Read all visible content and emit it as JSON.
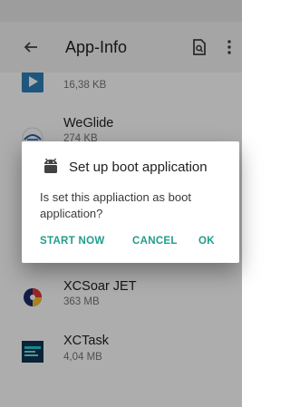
{
  "app_bar": {
    "title": "App-Info",
    "back_icon": "arrow-back-icon",
    "search_icon": "find-in-page-icon",
    "more_icon": "more-vert-icon"
  },
  "apps": [
    {
      "name": "",
      "size": "16,38 KB",
      "icon": "play-app-icon"
    },
    {
      "name": "WeGlide",
      "size": "274 KB",
      "icon": "weglide-icon"
    },
    {
      "name": "XCSoar JET",
      "size": "363 MB",
      "icon": "xcsoar-icon"
    },
    {
      "name": "XCTask",
      "size": "4,04 MB",
      "icon": "xctask-icon"
    }
  ],
  "dialog": {
    "icon": "android-icon",
    "title": "Set up boot application",
    "message": "Is set this appliaction as boot application?",
    "buttons": {
      "start_now": "START NOW",
      "cancel": "CANCEL",
      "ok": "OK"
    }
  },
  "colors": {
    "accent": "#1f9e8a",
    "scrim": "rgba(0,0,0,0.32)"
  }
}
